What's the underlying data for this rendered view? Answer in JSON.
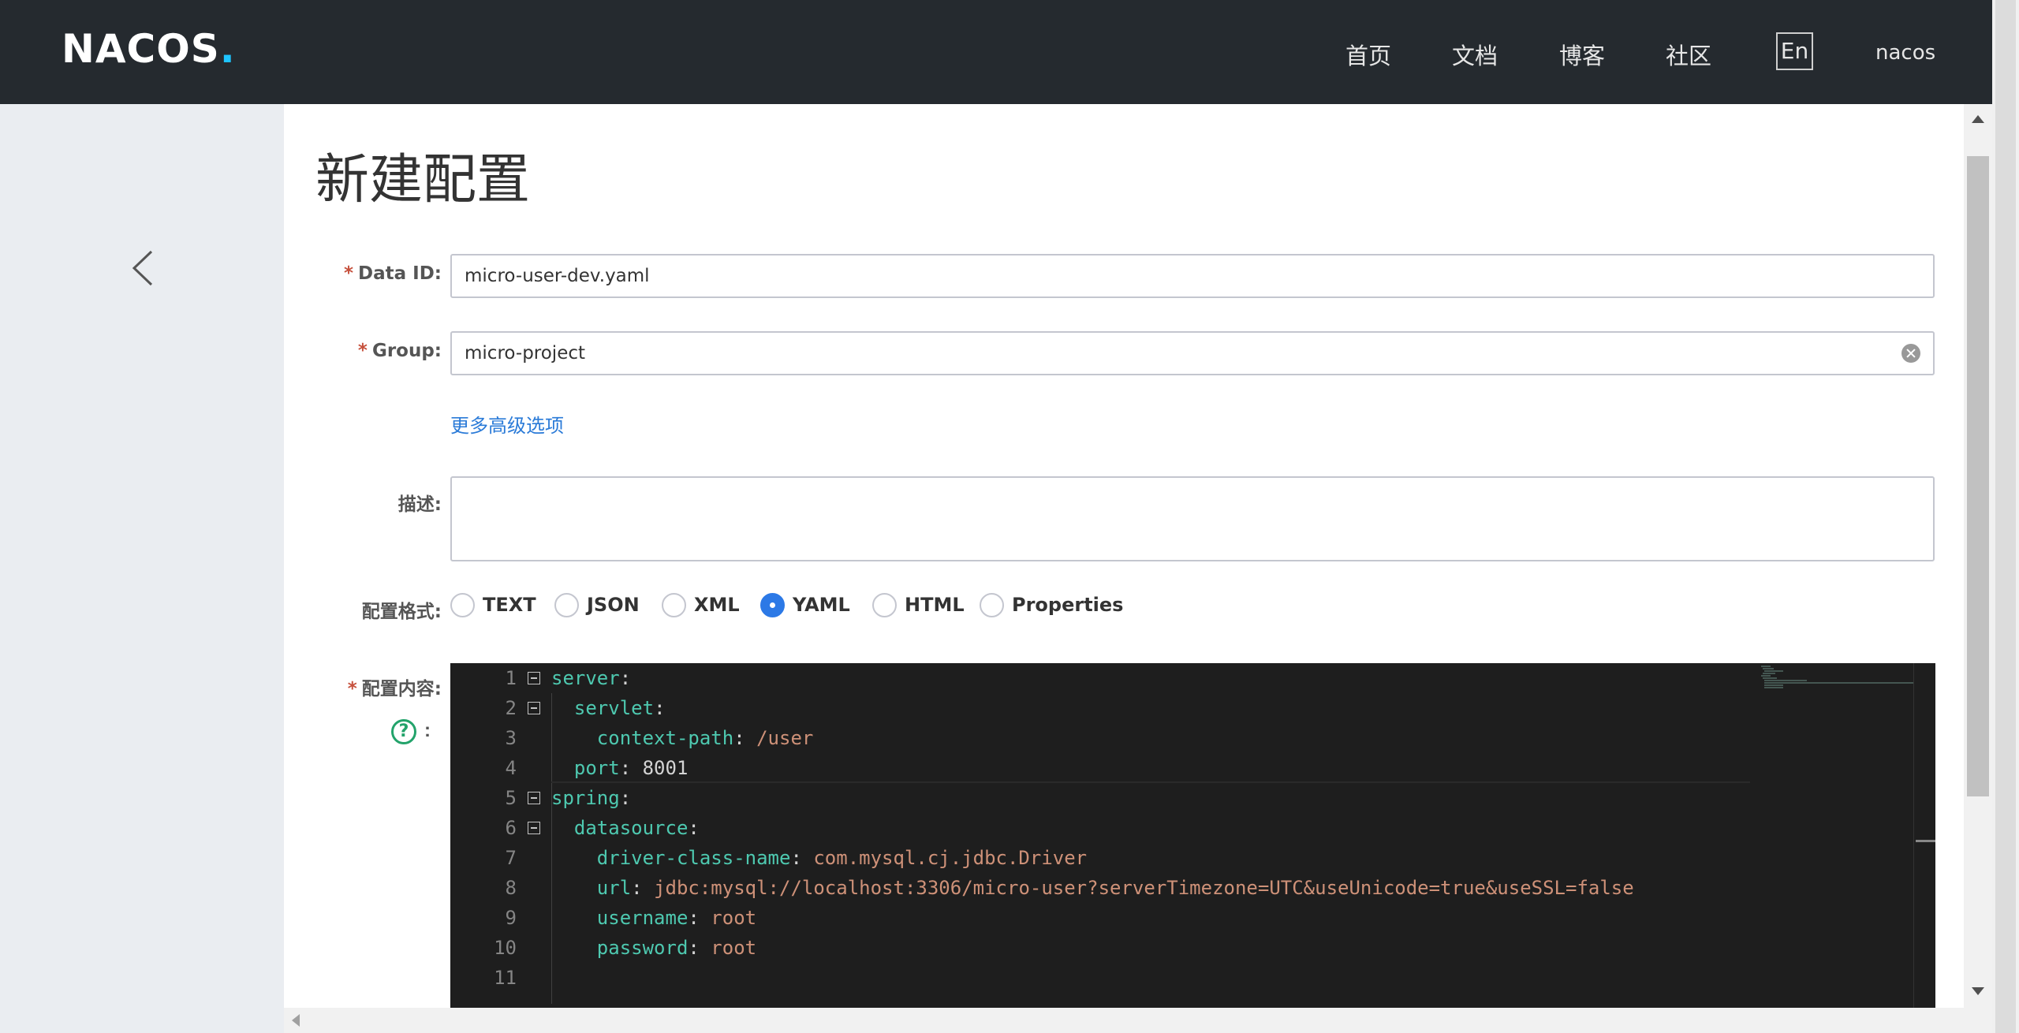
{
  "header": {
    "logo": "NACOS",
    "logo_dot": ".",
    "nav": [
      "首页",
      "文档",
      "博客",
      "社区"
    ],
    "lang": "En",
    "user": "nacos"
  },
  "page": {
    "title": "新建配置"
  },
  "form": {
    "data_id": {
      "required": "*",
      "label": "Data ID:",
      "value": "micro-user-dev.yaml"
    },
    "group": {
      "required": "*",
      "label": "Group:",
      "value": "micro-project"
    },
    "advanced_link": "更多高级选项",
    "description": {
      "label": "描述:",
      "value": ""
    },
    "format": {
      "label": "配置格式:",
      "options": [
        "TEXT",
        "JSON",
        "XML",
        "YAML",
        "HTML",
        "Properties"
      ],
      "selected": "YAML"
    },
    "content": {
      "required": "*",
      "label": "配置内容:",
      "help": "?",
      "help_colon": ":"
    }
  },
  "editor": {
    "lines": [
      {
        "num": "1",
        "fold": true,
        "tokens": [
          {
            "c": "k",
            "t": "server"
          },
          {
            "c": "n",
            "t": ":"
          }
        ]
      },
      {
        "num": "2",
        "fold": true,
        "tokens": [
          {
            "c": "n",
            "t": "  "
          },
          {
            "c": "k",
            "t": "servlet"
          },
          {
            "c": "n",
            "t": ":"
          }
        ]
      },
      {
        "num": "3",
        "fold": false,
        "tokens": [
          {
            "c": "n",
            "t": "    "
          },
          {
            "c": "k",
            "t": "context-path"
          },
          {
            "c": "n",
            "t": ": "
          },
          {
            "c": "s",
            "t": "/user"
          }
        ]
      },
      {
        "num": "4",
        "fold": false,
        "tokens": [
          {
            "c": "n",
            "t": "  "
          },
          {
            "c": "k",
            "t": "port"
          },
          {
            "c": "n",
            "t": ": 8001"
          }
        ]
      },
      {
        "num": "5",
        "fold": true,
        "tokens": [
          {
            "c": "k",
            "t": "spring"
          },
          {
            "c": "n",
            "t": ":"
          }
        ]
      },
      {
        "num": "6",
        "fold": true,
        "tokens": [
          {
            "c": "n",
            "t": "  "
          },
          {
            "c": "k",
            "t": "datasource"
          },
          {
            "c": "n",
            "t": ":"
          }
        ]
      },
      {
        "num": "7",
        "fold": false,
        "tokens": [
          {
            "c": "n",
            "t": "    "
          },
          {
            "c": "k",
            "t": "driver-class-name"
          },
          {
            "c": "n",
            "t": ": "
          },
          {
            "c": "s",
            "t": "com.mysql.cj.jdbc.Driver"
          }
        ]
      },
      {
        "num": "8",
        "fold": false,
        "tokens": [
          {
            "c": "n",
            "t": "    "
          },
          {
            "c": "k",
            "t": "url"
          },
          {
            "c": "n",
            "t": ": "
          },
          {
            "c": "s",
            "t": "jdbc:mysql://localhost:3306/micro-user?serverTimezone=UTC&useUnicode=true&useSSL=false"
          }
        ]
      },
      {
        "num": "9",
        "fold": false,
        "tokens": [
          {
            "c": "n",
            "t": "    "
          },
          {
            "c": "k",
            "t": "username"
          },
          {
            "c": "n",
            "t": ": "
          },
          {
            "c": "s",
            "t": "root"
          }
        ]
      },
      {
        "num": "10",
        "fold": false,
        "tokens": [
          {
            "c": "n",
            "t": "    "
          },
          {
            "c": "k",
            "t": "password"
          },
          {
            "c": "n",
            "t": ": "
          },
          {
            "c": "s",
            "t": "root"
          }
        ]
      },
      {
        "num": "11",
        "fold": false,
        "tokens": []
      }
    ]
  },
  "colors": {
    "header_bg": "#252a2f",
    "accent": "#2c79e6",
    "required": "#c6503c",
    "help": "#23a36b",
    "editor_bg": "#1e1e1e"
  },
  "icons": {
    "back": "chevron-left-icon",
    "clear": "clear-circle-icon",
    "help": "question-circle-icon"
  }
}
